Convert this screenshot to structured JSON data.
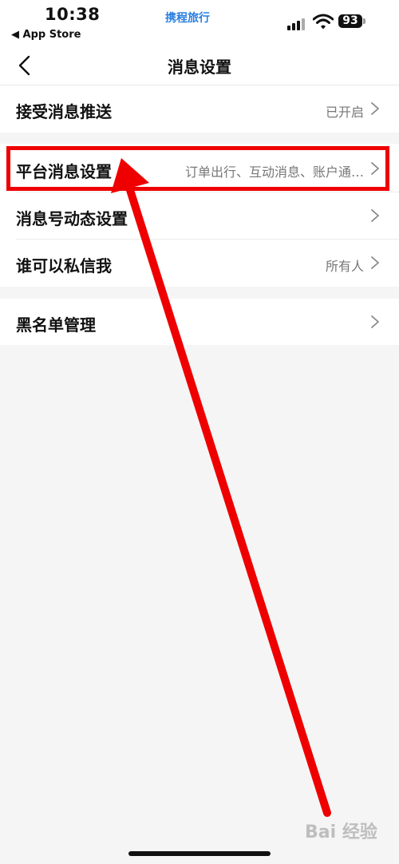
{
  "status_bar": {
    "time": "10:38",
    "back_app": "◀ App Store",
    "carrier_logo": "携程旅行",
    "battery": "93"
  },
  "nav": {
    "title": "消息设置"
  },
  "settings": {
    "push": {
      "label": "接受消息推送",
      "value": "已开启"
    },
    "platform": {
      "label": "平台消息设置",
      "value": "订单出行、互动消息、账户通…"
    },
    "account_dynamics": {
      "label": "消息号动态设置",
      "value": ""
    },
    "private_message": {
      "label": "谁可以私信我",
      "value": "所有人"
    },
    "blacklist": {
      "label": "黑名单管理",
      "value": ""
    }
  },
  "annotation": {
    "highlight_color": "#ee0000"
  },
  "watermark": {
    "text": "Bai 经验"
  },
  "colors": {
    "background": "#f5f5f5",
    "accent_logo": "#2a7fe0"
  }
}
